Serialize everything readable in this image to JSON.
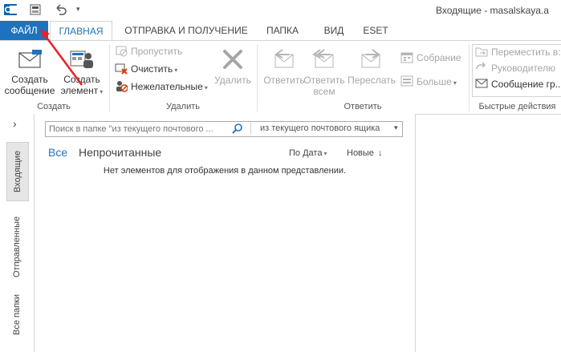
{
  "titlebar": {
    "title": "Входящие - masalskaya.a"
  },
  "tabs": {
    "file": "ФАЙЛ",
    "home": "ГЛАВНАЯ",
    "send_receive": "ОТПРАВКА И ПОЛУЧЕНИЕ",
    "folder": "ПАПКА",
    "view": "ВИД",
    "eset": "ESET"
  },
  "ribbon": {
    "create": {
      "new_email_line1": "Создать",
      "new_email_line2": "сообщение",
      "new_item_line1": "Создать",
      "new_item_line2": "элемент",
      "group_label": "Создать"
    },
    "delete": {
      "ignore": "Пропустить",
      "clean_up": "Очистить",
      "junk": "Нежелательные",
      "delete": "Удалить",
      "group_label": "Удалить"
    },
    "respond": {
      "reply": "Ответить",
      "reply_all_line1": "Ответить",
      "reply_all_line2": "всем",
      "forward": "Переслать",
      "meeting": "Собрание",
      "more": "Больше",
      "group_label": "Ответить"
    },
    "quick_steps": {
      "move_to": "Переместить в:",
      "to_manager": "Руководителю",
      "team_email": "Сообщение гр...",
      "group_label": "Быстрые действия"
    }
  },
  "leftnav": {
    "expand": "›",
    "inbox": "Входящие",
    "sent": "Отправленные",
    "all_folders": "Все папки"
  },
  "list": {
    "search_placeholder": "Поиск в папке \"из текущего почтового ...",
    "search_scope": "из текущего почтового ящика",
    "filter_all": "Все",
    "filter_unread": "Непрочитанные",
    "sort_by": "По Дата",
    "sort_order": "Новые",
    "empty_message": "Нет элементов для отображения в данном представлении."
  },
  "colors": {
    "accent": "#1e73be",
    "annotation": "#e8202a"
  }
}
